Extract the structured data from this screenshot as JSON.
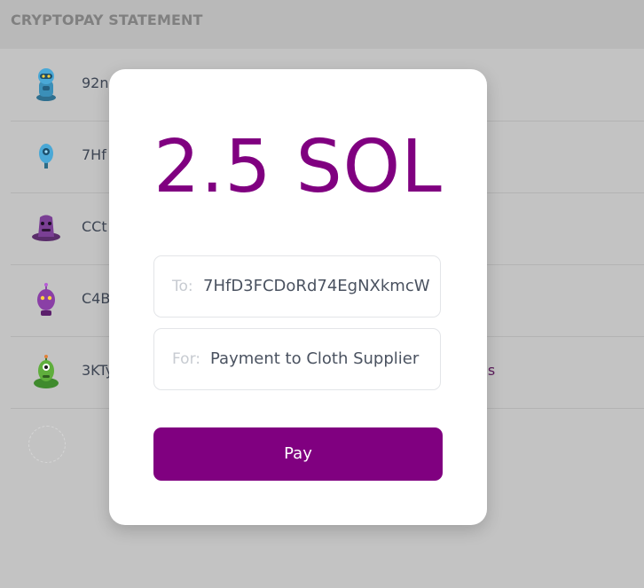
{
  "header": {
    "title": "CRYPTOPAY STATEMENT"
  },
  "transactions": [
    {
      "address": "92n",
      "memo": "",
      "avatar": "blue-robot-icon"
    },
    {
      "address": "7Hf",
      "memo": "",
      "avatar": "blue-sensor-icon"
    },
    {
      "address": "CCt",
      "memo": "",
      "avatar": "purple-wizard-icon"
    },
    {
      "address": "C4B",
      "memo": "",
      "avatar": "purple-alien-icon"
    },
    {
      "address": "3KTy",
      "memo": "es",
      "avatar": "green-alien-icon"
    },
    {
      "address": "",
      "memo": "",
      "avatar": "empty-avatar-placeholder"
    }
  ],
  "modal": {
    "amount": "2.5 SOL",
    "to_label": "To:",
    "to_value": "7HfD3FCDoRd74EgNXkmcW",
    "for_label": "For:",
    "for_value": "Payment to Cloth Supplier",
    "pay_label": "Pay"
  },
  "colors": {
    "accent": "#800080",
    "overlay": "#c3c3c3",
    "header": "#b9b9b9"
  }
}
